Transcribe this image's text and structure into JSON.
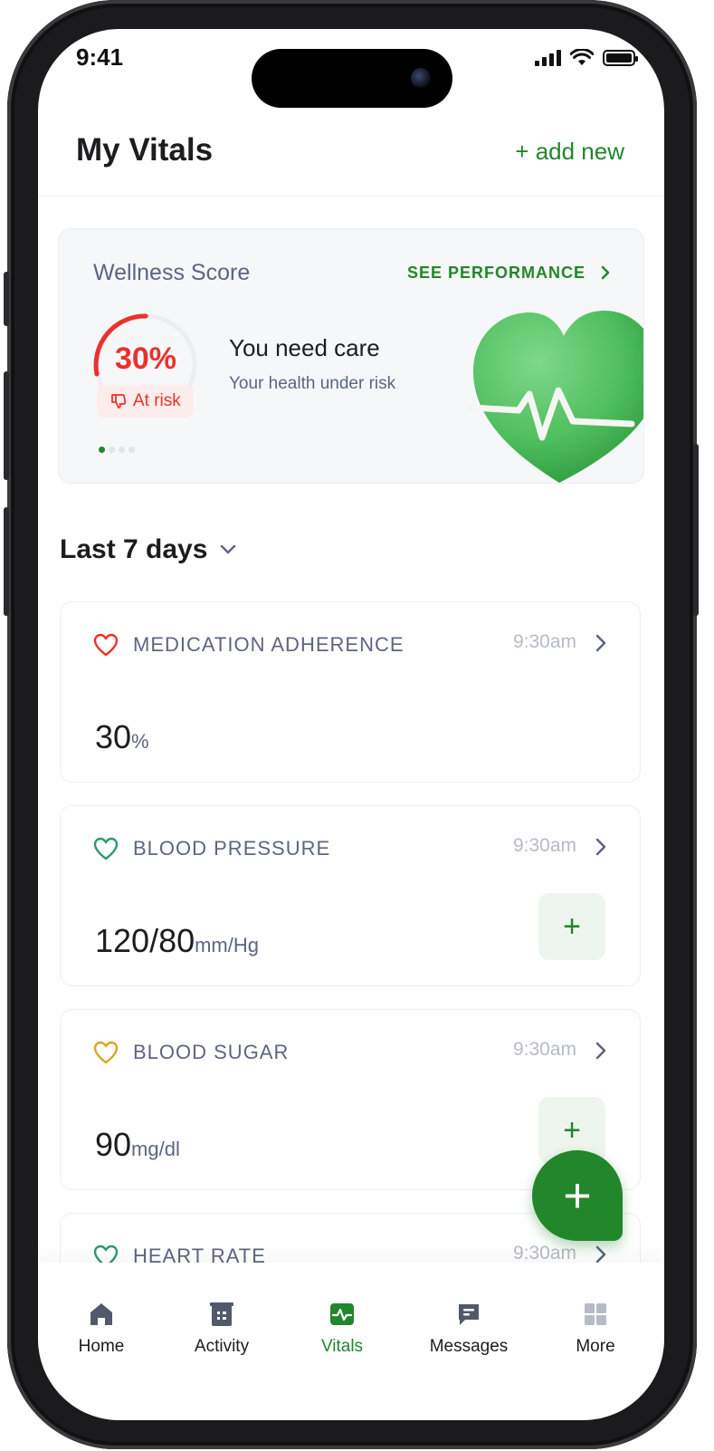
{
  "status_bar": {
    "time": "9:41"
  },
  "header": {
    "title": "My Vitals",
    "add_new_label": "+ add new"
  },
  "wellness": {
    "title": "Wellness Score",
    "see_performance_label": "SEE PERFORMANCE",
    "score_percent": 30,
    "score_label": "30%",
    "risk_label": "At risk",
    "heading": "You need care",
    "subtext": "Your health under risk",
    "carousel_active_index": 0,
    "carousel_count": 4
  },
  "range": {
    "label": "Last 7 days"
  },
  "vitals": [
    {
      "name": "MEDICATION ADHERENCE",
      "time": "9:30am",
      "value": "30",
      "unit": "%",
      "icon_color": "#e8322b",
      "has_add": false
    },
    {
      "name": "BLOOD PRESSURE",
      "time": "9:30am",
      "value": "120/80",
      "unit": "mm/Hg",
      "icon_color": "#2d9a6b",
      "has_add": true
    },
    {
      "name": "BLOOD SUGAR",
      "time": "9:30am",
      "value": "90",
      "unit": "mg/dl",
      "icon_color": "#d8a526",
      "has_add": true
    },
    {
      "name": "HEART RATE",
      "time": "9:30am",
      "value": "",
      "unit": "",
      "icon_color": "#2d9a6b",
      "has_add": false
    }
  ],
  "fab": {
    "label": "+"
  },
  "add_button_label": "+",
  "tabbar": {
    "items": [
      {
        "label": "Home",
        "icon": "home-icon"
      },
      {
        "label": "Activity",
        "icon": "activity-icon"
      },
      {
        "label": "Vitals",
        "icon": "vitals-icon",
        "active": true
      },
      {
        "label": "Messages",
        "icon": "messages-icon"
      },
      {
        "label": "More",
        "icon": "more-icon"
      }
    ]
  },
  "colors": {
    "accent": "#22862a",
    "danger": "#e8322b",
    "muted": "#5d6680"
  }
}
